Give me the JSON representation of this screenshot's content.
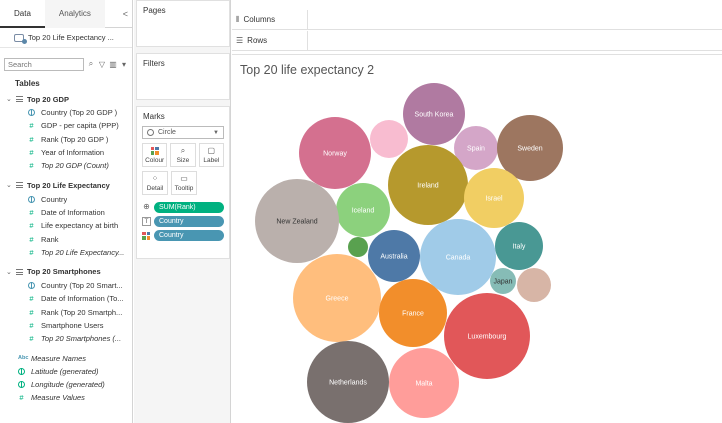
{
  "data_pane": {
    "tabs": [
      "Data",
      "Analytics"
    ],
    "collapse_glyph": "<",
    "datasource": "Top 20 Life Expectancy ...",
    "search_placeholder": "Search",
    "tables_title": "Tables",
    "groups": [
      {
        "name": "Top 20 GDP",
        "fields": [
          {
            "name": "Country (Top 20 GDP )",
            "kind": "globe",
            "italic": false
          },
          {
            "name": "GDP - per capita (PPP)",
            "kind": "measure",
            "italic": false
          },
          {
            "name": "Rank (Top 20 GDP )",
            "kind": "measure",
            "italic": false
          },
          {
            "name": "Year of Information",
            "kind": "measure",
            "italic": false
          },
          {
            "name": "Top 20 GDP  (Count)",
            "kind": "measure",
            "italic": true
          }
        ]
      },
      {
        "name": "Top 20 Life Expectancy",
        "fields": [
          {
            "name": "Country",
            "kind": "globe",
            "italic": false
          },
          {
            "name": "Date of Information",
            "kind": "measure",
            "italic": false
          },
          {
            "name": "Life expectancy at birth",
            "kind": "measure",
            "italic": false
          },
          {
            "name": "Rank",
            "kind": "measure",
            "italic": false
          },
          {
            "name": "Top 20 Life Expectancy...",
            "kind": "measure",
            "italic": true
          }
        ]
      },
      {
        "name": "Top 20 Smartphones",
        "fields": [
          {
            "name": "Country (Top 20 Smart...",
            "kind": "globe",
            "italic": false
          },
          {
            "name": "Date of Information (To...",
            "kind": "measure",
            "italic": false
          },
          {
            "name": "Rank (Top 20 Smartph...",
            "kind": "measure",
            "italic": false
          },
          {
            "name": "Smartphone Users",
            "kind": "measure",
            "italic": false
          },
          {
            "name": "Top 20 Smartphones (...",
            "kind": "measure",
            "italic": true
          }
        ]
      }
    ],
    "loose_fields": [
      {
        "name": "Measure Names",
        "kind": "abc",
        "italic": true
      },
      {
        "name": "Latitude (generated)",
        "kind": "globe-green",
        "italic": true
      },
      {
        "name": "Longitude (generated)",
        "kind": "globe-green",
        "italic": true
      },
      {
        "name": "Measure Values",
        "kind": "measure",
        "italic": true
      }
    ]
  },
  "cards": {
    "pages": "Pages",
    "filters": "Filters",
    "marks": "Marks",
    "mark_type": "Circle",
    "mark_buttons": [
      {
        "label": "Colour",
        "icon": "color-grid-icon"
      },
      {
        "label": "Size",
        "icon": "size-icon"
      },
      {
        "label": "Label",
        "icon": "label-icon"
      },
      {
        "label": "Detail",
        "icon": "detail-icon"
      },
      {
        "label": "Tooltip",
        "icon": "tooltip-icon"
      }
    ],
    "pills": [
      {
        "glyph_icon": "size-icon",
        "text": "SUM(Rank)",
        "kind": "measure"
      },
      {
        "glyph_icon": "label-icon",
        "text": "Country",
        "kind": "dimension"
      },
      {
        "glyph_icon": "color-grid-icon",
        "text": "Country",
        "kind": "dimension"
      }
    ]
  },
  "shelves": {
    "columns": "Columns",
    "rows": "Rows"
  },
  "sheet_title": "Top 20 life expectancy 2",
  "chart_data": {
    "type": "bubble",
    "title": "Top 20 life expectancy 2",
    "bubbles": [
      {
        "label": "South Korea",
        "color": "#b07aa1"
      },
      {
        "label": "",
        "color": "#f8bcd0"
      },
      {
        "label": "Norway",
        "color": "#d4708f"
      },
      {
        "label": "Spain",
        "color": "#d4a6c8"
      },
      {
        "label": "Sweden",
        "color": "#9d7660"
      },
      {
        "label": "Ireland",
        "color": "#b6992d"
      },
      {
        "label": "Israel",
        "color": "#f1ce63"
      },
      {
        "label": "Iceland",
        "color": "#8cd17d"
      },
      {
        "label": "New Zealand",
        "color": "#bab0ac"
      },
      {
        "label": "Canada",
        "color": "#a0cbe8"
      },
      {
        "label": "Italy",
        "color": "#499894"
      },
      {
        "label": "",
        "color": "#59a14f"
      },
      {
        "label": "Australia",
        "color": "#4e79a7"
      },
      {
        "label": "Japan",
        "color": "#86bcb6"
      },
      {
        "label": "",
        "color": "#d7b5a6"
      },
      {
        "label": "Greece",
        "color": "#ffbe7d"
      },
      {
        "label": "France",
        "color": "#f28e2b"
      },
      {
        "label": "Luxembourg",
        "color": "#e15759"
      },
      {
        "label": "Netherlands",
        "color": "#79706e"
      },
      {
        "label": "Malta",
        "color": "#ff9d9a"
      }
    ]
  }
}
